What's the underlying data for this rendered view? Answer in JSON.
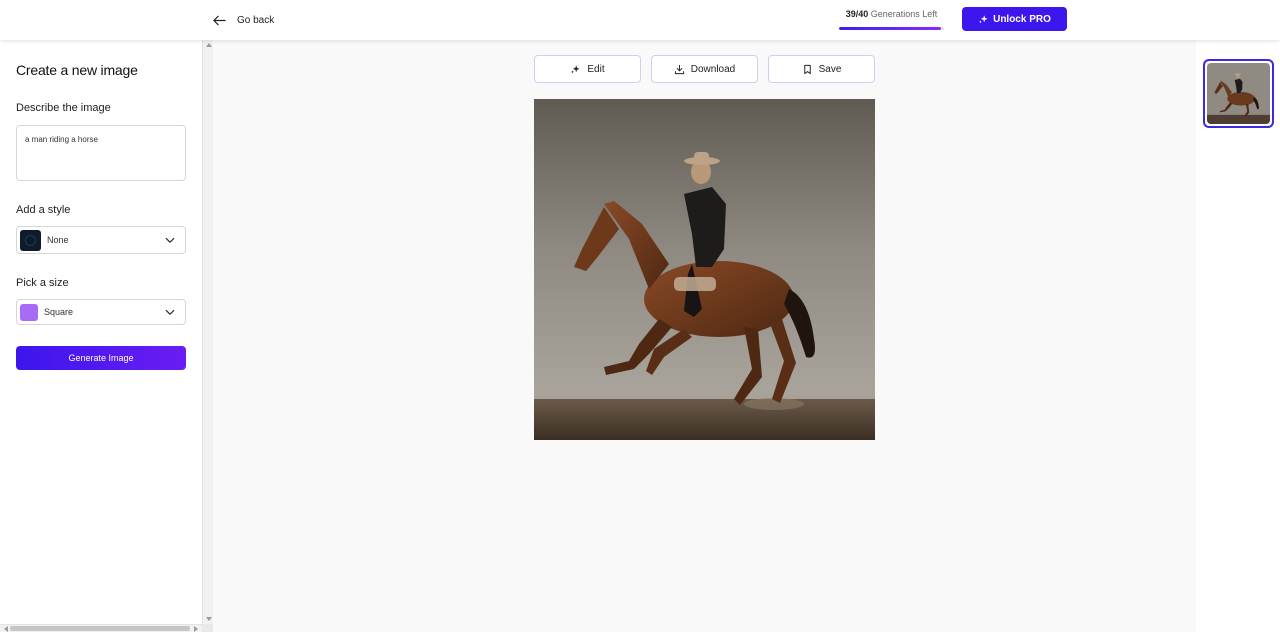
{
  "header": {
    "go_back_label": "Go back",
    "generations_used": "39/40",
    "generations_label": "Generations Left",
    "generations_fraction": 0.975,
    "unlock_label": "Unlock PRO"
  },
  "sidebar": {
    "title": "Create a new image",
    "describe_label": "Describe the image",
    "prompt_value": "a man riding a horse",
    "style_label": "Add a style",
    "style_value": "None",
    "size_label": "Pick a size",
    "size_value": "Square",
    "generate_label": "Generate Image"
  },
  "toolbar": {
    "edit_label": "Edit",
    "download_label": "Download",
    "save_label": "Save"
  },
  "icons": {
    "back": "arrow-left-icon",
    "sparkle": "sparkle-icon",
    "download": "download-icon",
    "bookmark": "bookmark-icon",
    "chevron": "chevron-down-icon"
  },
  "colors": {
    "accent": "#3d16ee",
    "accent_gradient_end": "#6a1df2",
    "size_swatch": "#a66cf7",
    "style_swatch": "#0d1b2a"
  }
}
